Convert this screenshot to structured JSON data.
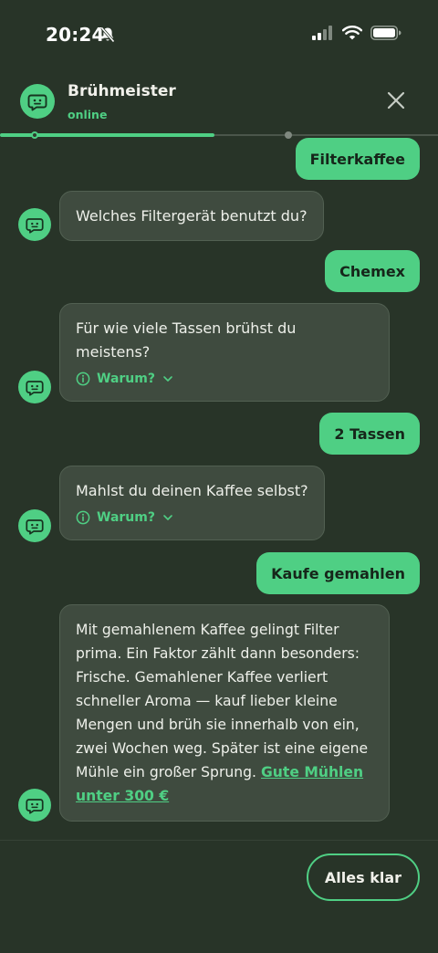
{
  "status_bar": {
    "time": "20:24"
  },
  "header": {
    "bot_name": "Brühmeister",
    "status": "online"
  },
  "progress": {
    "fraction": 0.49
  },
  "messages": [
    {
      "from": "user",
      "text": "Filterkaffee"
    },
    {
      "from": "bot",
      "text": "Welches Filtergerät benutzt du?"
    },
    {
      "from": "user",
      "text": "Chemex"
    },
    {
      "from": "bot",
      "text": "Für wie viele Tassen brühst du meistens?",
      "why": "Warum?"
    },
    {
      "from": "user",
      "text": "2 Tassen"
    },
    {
      "from": "bot",
      "text": "Mahlst du deinen Kaffee selbst?",
      "why": "Warum?"
    },
    {
      "from": "user",
      "text": "Kaufe gemahlen"
    },
    {
      "from": "bot",
      "text": "Mit gemahlenem Kaffee gelingt Filter prima. Ein Faktor zählt dann besonders: Frische. Gemahlener Kaffee verliert schneller Aroma — kauf lieber kleine Mengen und brüh sie innerhalb von ein, zwei Wochen weg. Später ist eine eigene Mühle ein großer Sprung.",
      "link": "Gute Mühlen unter 300 €"
    }
  ],
  "footer": {
    "button_label": "Alles klar"
  },
  "colors": {
    "accent": "#4fcf84",
    "background": "#283428",
    "bot_bubble": "#3f4b3f"
  },
  "icons": {
    "status": [
      "bell-slash-icon",
      "signal-icon",
      "wifi-icon",
      "battery-icon"
    ],
    "bot": "robot-face-icon",
    "close": "close-icon",
    "why": "info-icon",
    "expand": "chevron-down-icon"
  }
}
